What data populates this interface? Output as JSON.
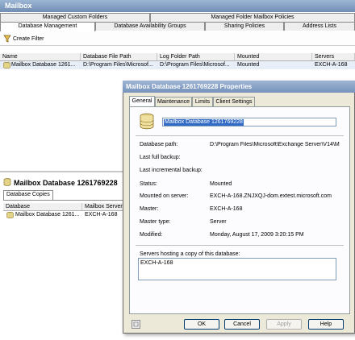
{
  "window": {
    "title": "Mailbox"
  },
  "tabs_row1": [
    "Managed Custom Folders",
    "Managed Folder Mailbox Policies"
  ],
  "tabs_row2": [
    "Database Management",
    "Database Availability Groups",
    "Sharing Policies",
    "Address Lists"
  ],
  "toolbar": {
    "create_filter": "Create Filter"
  },
  "grid": {
    "columns": [
      "Name",
      "Database File Path",
      "Log Folder Path",
      "Mounted",
      "Servers"
    ],
    "row": [
      "Mailbox Database 1261...",
      "D:\\Program Files\\Microsof...",
      "D:\\Program Files\\Microsof...",
      "Mounted",
      "EXCH-A-168"
    ]
  },
  "bottom_pane": {
    "title": "Mailbox Database 1261769228",
    "tab": "Database Copies",
    "columns": [
      "Database",
      "Mailbox Server"
    ],
    "row": [
      "Mailbox Database 1261...",
      "EXCH-A-168"
    ]
  },
  "dialog": {
    "title": "Mailbox Database 1261769228 Properties",
    "tabs": [
      "General",
      "Maintenance",
      "Limits",
      "Client Settings"
    ],
    "name_value": "Mailbox Database 1261769228",
    "fields": {
      "database_path_label": "Database path:",
      "database_path_value": "D:\\Program Files\\Microsoft\\Exchange Server\\V14\\M",
      "last_full_backup_label": "Last full backup:",
      "last_incremental_backup_label": "Last incremental backup:",
      "status_label": "Status:",
      "status_value": "Mounted",
      "mounted_on_label": "Mounted on server:",
      "mounted_on_value": "EXCH-A-168.ZNJXQJ-dom.extest.microsoft.com",
      "master_label": "Master:",
      "master_value": "EXCH-A-168",
      "master_type_label": "Master type:",
      "master_type_value": "Server",
      "modified_label": "Modified:",
      "modified_value": "Monday, August 17, 2009 3:20:15 PM"
    },
    "servers_label": "Servers hosting a copy of this database:",
    "servers": [
      "EXCH-A-168"
    ],
    "buttons": {
      "ok": "OK",
      "cancel": "Cancel",
      "apply": "Apply",
      "help": "Help"
    }
  },
  "colors": {
    "title_bar": "#7f9bc0",
    "selection": "#316ac5",
    "dialog_bg": "#ece9d8"
  },
  "icons": [
    "filter-icon",
    "database-icon",
    "database-large-icon",
    "help-icon"
  ]
}
